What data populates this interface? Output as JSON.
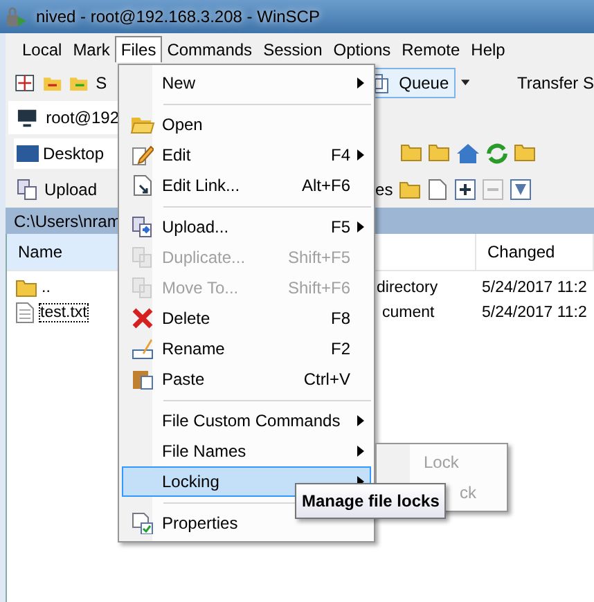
{
  "window": {
    "title": "nived - root@192.168.3.208 - WinSCP"
  },
  "menubar": [
    {
      "label": "Local",
      "selected": false
    },
    {
      "label": "Mark",
      "selected": false
    },
    {
      "label": "Files",
      "selected": true
    },
    {
      "label": "Commands",
      "selected": false
    },
    {
      "label": "Session",
      "selected": false
    },
    {
      "label": "Options",
      "selected": false
    },
    {
      "label": "Remote",
      "selected": false
    },
    {
      "label": "Help",
      "selected": false
    }
  ],
  "toolbar": {
    "cut_label": "S",
    "queue_button": "Queue",
    "transfer_label": "Transfer S"
  },
  "session_tab": {
    "label": "root@192"
  },
  "local_panel": {
    "location": "Desktop",
    "upload_button": "Upload",
    "cut_label": "es",
    "path": "C:\\Users\\nram",
    "columns": [
      {
        "label": "Name"
      },
      {
        "label": "Changed"
      }
    ],
    "rows": [
      {
        "name": "..",
        "kind": "parent",
        "type": "directory",
        "changed": "5/24/2017  11:2"
      },
      {
        "name": "test.txt",
        "kind": "file",
        "type": "cument",
        "changed": "5/24/2017  11:2"
      }
    ]
  },
  "files_menu": [
    {
      "kind": "item",
      "label": "New",
      "submenu": true,
      "disabled": false,
      "selected": false
    },
    {
      "kind": "separator"
    },
    {
      "kind": "item",
      "label": "Open",
      "submenu": false,
      "disabled": false,
      "selected": false
    },
    {
      "kind": "item",
      "label": "Edit",
      "shortcut": "F4",
      "submenu": true,
      "disabled": false,
      "selected": false
    },
    {
      "kind": "item",
      "label": "Edit Link...",
      "shortcut": "Alt+F6",
      "submenu": false,
      "disabled": false,
      "selected": false
    },
    {
      "kind": "separator"
    },
    {
      "kind": "item",
      "label": "Upload...",
      "shortcut": "F5",
      "submenu": true,
      "disabled": false,
      "selected": false
    },
    {
      "kind": "item",
      "label": "Duplicate...",
      "shortcut": "Shift+F5",
      "submenu": false,
      "disabled": true,
      "selected": false
    },
    {
      "kind": "item",
      "label": "Move To...",
      "shortcut": "Shift+F6",
      "submenu": false,
      "disabled": true,
      "selected": false
    },
    {
      "kind": "item",
      "label": "Delete",
      "shortcut": "F8",
      "submenu": false,
      "disabled": false,
      "selected": false
    },
    {
      "kind": "item",
      "label": "Rename",
      "shortcut": "F2",
      "submenu": false,
      "disabled": false,
      "selected": false
    },
    {
      "kind": "item",
      "label": "Paste",
      "shortcut": "Ctrl+V",
      "submenu": false,
      "disabled": false,
      "selected": false
    },
    {
      "kind": "separator"
    },
    {
      "kind": "item",
      "label": "File Custom Commands",
      "submenu": true,
      "disabled": false,
      "selected": false
    },
    {
      "kind": "item",
      "label": "File Names",
      "submenu": true,
      "disabled": false,
      "selected": false
    },
    {
      "kind": "item",
      "label": "Locking",
      "submenu": true,
      "disabled": false,
      "selected": true
    },
    {
      "kind": "separator"
    },
    {
      "kind": "item",
      "label": "Properties",
      "submenu": false,
      "disabled": false,
      "selected": false
    }
  ],
  "locking_submenu": [
    {
      "label": "Lock",
      "disabled": true
    },
    {
      "label": "ck",
      "disabled": true
    }
  ],
  "tooltip": {
    "text": "Manage file locks"
  }
}
